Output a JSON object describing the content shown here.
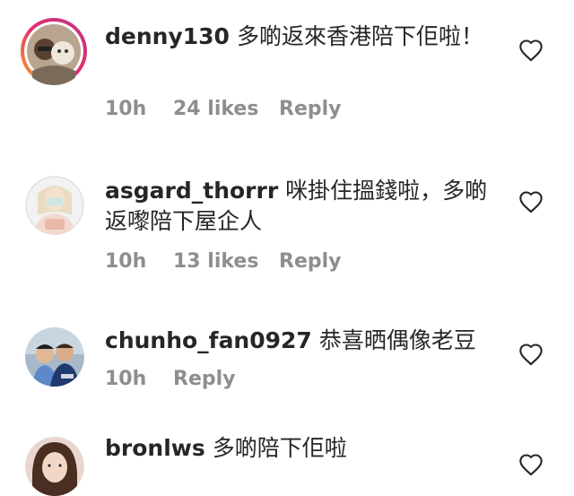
{
  "comments": [
    {
      "username": "denny130",
      "text": "多啲返來香港陪下佢啦！",
      "time": "10h",
      "likes": "24 likes",
      "reply": "Reply",
      "story_ring": true
    },
    {
      "username": "asgard_thorrr",
      "text": "咪掛住搵錢啦，多啲返嚟陪下屋企人",
      "time": "10h",
      "likes": "13 likes",
      "reply": "Reply",
      "story_ring": false
    },
    {
      "username": "chunho_fan0927",
      "text": "恭喜晒偶像老豆",
      "time": "10h",
      "reply": "Reply",
      "story_ring": false
    },
    {
      "username": "bronlws",
      "text": "多啲陪下佢啦",
      "story_ring": false
    }
  ],
  "colors": {
    "text": "#262626",
    "secondary": "#8e8e8e",
    "story_ring_start": "#f9a825",
    "story_ring_end": "#c13584"
  },
  "icons": {
    "like": "heart-outline-icon"
  }
}
